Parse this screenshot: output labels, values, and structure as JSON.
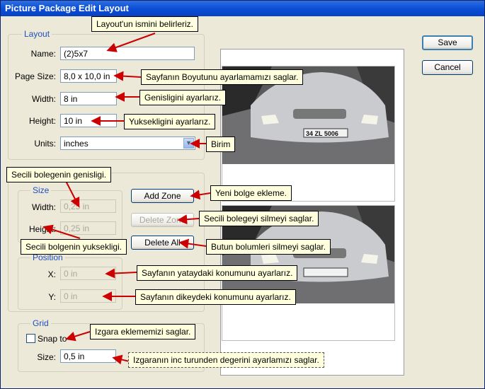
{
  "window": {
    "title": "Picture Package Edit Layout"
  },
  "buttons": {
    "save": "Save",
    "cancel": "Cancel",
    "add_zone": "Add Zone",
    "delete_zone": "Delete Zone",
    "delete_all": "Delete All"
  },
  "layout": {
    "legend": "Layout",
    "name_label": "Name:",
    "name_value": "(2)5x7",
    "page_size_label": "Page Size:",
    "page_size_value": "8,0 x 10,0 in",
    "width_label": "Width:",
    "width_value": "8 in",
    "height_label": "Height:",
    "height_value": "10 in",
    "units_label": "Units:",
    "units_value": "inches"
  },
  "size": {
    "legend": "Size",
    "width_label": "Width:",
    "width_value": "0,25 in",
    "height_label": "Height:",
    "height_value": "0,25 in"
  },
  "position": {
    "legend": "Position",
    "x_label": "X:",
    "x_value": "0 in",
    "y_label": "Y:",
    "y_value": "0 in"
  },
  "grid": {
    "legend": "Grid",
    "snap_label": "Snap to",
    "size_label": "Size:",
    "size_value": "0,5 in"
  },
  "photo": {
    "plate": "34 ZL 5006"
  },
  "callouts": {
    "name": "Layout'un ismini belirleriz.",
    "page_size": "Sayfanın Boyutunu ayarlamamızı saglar.",
    "width": "Genisligini ayarlarız.",
    "height": "Yuksekligini ayarlarız.",
    "units": "Birim",
    "zone_width": "Secili bolegenin genisligi.",
    "add_zone": "Yeni bolge ekleme.",
    "delete_zone": "Secili bolegeyi silmeyi saglar.",
    "zone_height": "Secili bolgenin yuksekligi.",
    "delete_all": "Butun bolumleri silmeyi saglar.",
    "x": "Sayfanın yataydaki konumunu ayarlarız.",
    "y": "Sayfanın dikeydeki konumunu ayarlarız.",
    "snap": "Izgara eklememizi saglar.",
    "grid_size": "Izgaranın inc turunden degerini ayarlamızı saglar."
  },
  "colors": {
    "title_bar": "#0a4fd8",
    "legend_text": "#1f4fbf",
    "callout_bg": "#ffffdd",
    "arrow": "#cc0000"
  }
}
